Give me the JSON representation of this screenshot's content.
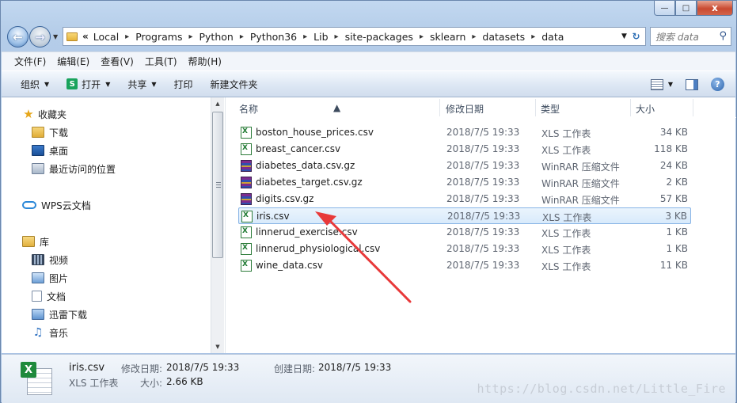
{
  "window": {
    "min_label": "—",
    "max_label": "□",
    "close_label": "x"
  },
  "address": {
    "chevron": "«",
    "crumbs": [
      "Local",
      "Programs",
      "Python",
      "Python36",
      "Lib",
      "site-packages",
      "sklearn",
      "datasets",
      "data"
    ]
  },
  "search": {
    "placeholder": "搜索 data"
  },
  "menu": [
    "文件(F)",
    "编辑(E)",
    "查看(V)",
    "工具(T)",
    "帮助(H)"
  ],
  "toolbar": {
    "organize": "组织",
    "open": "打开",
    "share": "共享",
    "print": "打印",
    "new_folder": "新建文件夹"
  },
  "nav": {
    "favorites": "收藏夹",
    "downloads": "下载",
    "desktop": "桌面",
    "recent": "最近访问的位置",
    "wps": "WPS云文档",
    "library": "库",
    "videos": "视频",
    "pictures": "图片",
    "documents": "文档",
    "thunder": "迅雷下载",
    "music": "音乐"
  },
  "columns": {
    "name": "名称",
    "date": "修改日期",
    "type": "类型",
    "size": "大小"
  },
  "files": [
    {
      "name": "boston_house_prices.csv",
      "date": "2018/7/5 19:33",
      "type": "XLS 工作表",
      "size": "34 KB",
      "icon": "xls"
    },
    {
      "name": "breast_cancer.csv",
      "date": "2018/7/5 19:33",
      "type": "XLS 工作表",
      "size": "118 KB",
      "icon": "xls"
    },
    {
      "name": "diabetes_data.csv.gz",
      "date": "2018/7/5 19:33",
      "type": "WinRAR 压缩文件",
      "size": "24 KB",
      "icon": "rar"
    },
    {
      "name": "diabetes_target.csv.gz",
      "date": "2018/7/5 19:33",
      "type": "WinRAR 压缩文件",
      "size": "2 KB",
      "icon": "rar"
    },
    {
      "name": "digits.csv.gz",
      "date": "2018/7/5 19:33",
      "type": "WinRAR 压缩文件",
      "size": "57 KB",
      "icon": "rar"
    },
    {
      "name": "iris.csv",
      "date": "2018/7/5 19:33",
      "type": "XLS 工作表",
      "size": "3 KB",
      "icon": "xls",
      "selected": true
    },
    {
      "name": "linnerud_exercise.csv",
      "date": "2018/7/5 19:33",
      "type": "XLS 工作表",
      "size": "1 KB",
      "icon": "xls"
    },
    {
      "name": "linnerud_physiological.csv",
      "date": "2018/7/5 19:33",
      "type": "XLS 工作表",
      "size": "1 KB",
      "icon": "xls"
    },
    {
      "name": "wine_data.csv",
      "date": "2018/7/5 19:33",
      "type": "XLS 工作表",
      "size": "11 KB",
      "icon": "xls"
    }
  ],
  "details": {
    "filename": "iris.csv",
    "filetype": "XLS 工作表",
    "modified_label": "修改日期:",
    "modified_value": "2018/7/5 19:33",
    "created_label": "创建日期:",
    "created_value": "2018/7/5 19:33",
    "size_label": "大小:",
    "size_value": "2.66 KB"
  },
  "watermark": "https://blog.csdn.net/Little_Fire",
  "colors": {
    "annotation_arrow": "#e8393a",
    "selection_border": "#88b4e6"
  }
}
